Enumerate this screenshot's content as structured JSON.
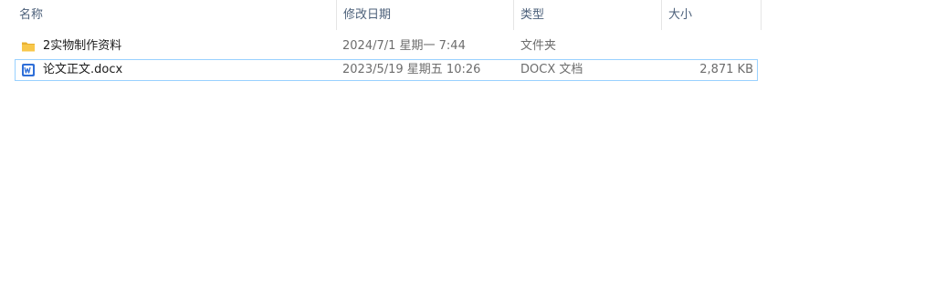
{
  "columns": {
    "name": "名称",
    "date": "修改日期",
    "type": "类型",
    "size": "大小"
  },
  "sort_indicator": "^",
  "files": [
    {
      "icon": "folder-icon",
      "name": "2实物制作资料",
      "modified": "2024/7/1 星期一 7:44",
      "type": "文件夹",
      "size": ""
    },
    {
      "icon": "word-document-icon",
      "name": "论文正文.docx",
      "modified": "2023/5/19 星期五 10:26",
      "type": "DOCX 文档",
      "size": "2,871 KB"
    }
  ],
  "colors": {
    "header_text": "#4c607a",
    "focus_border": "#99d1ff",
    "folder_yellow": "#f8c74a",
    "word_blue": "#2f6fd8"
  }
}
